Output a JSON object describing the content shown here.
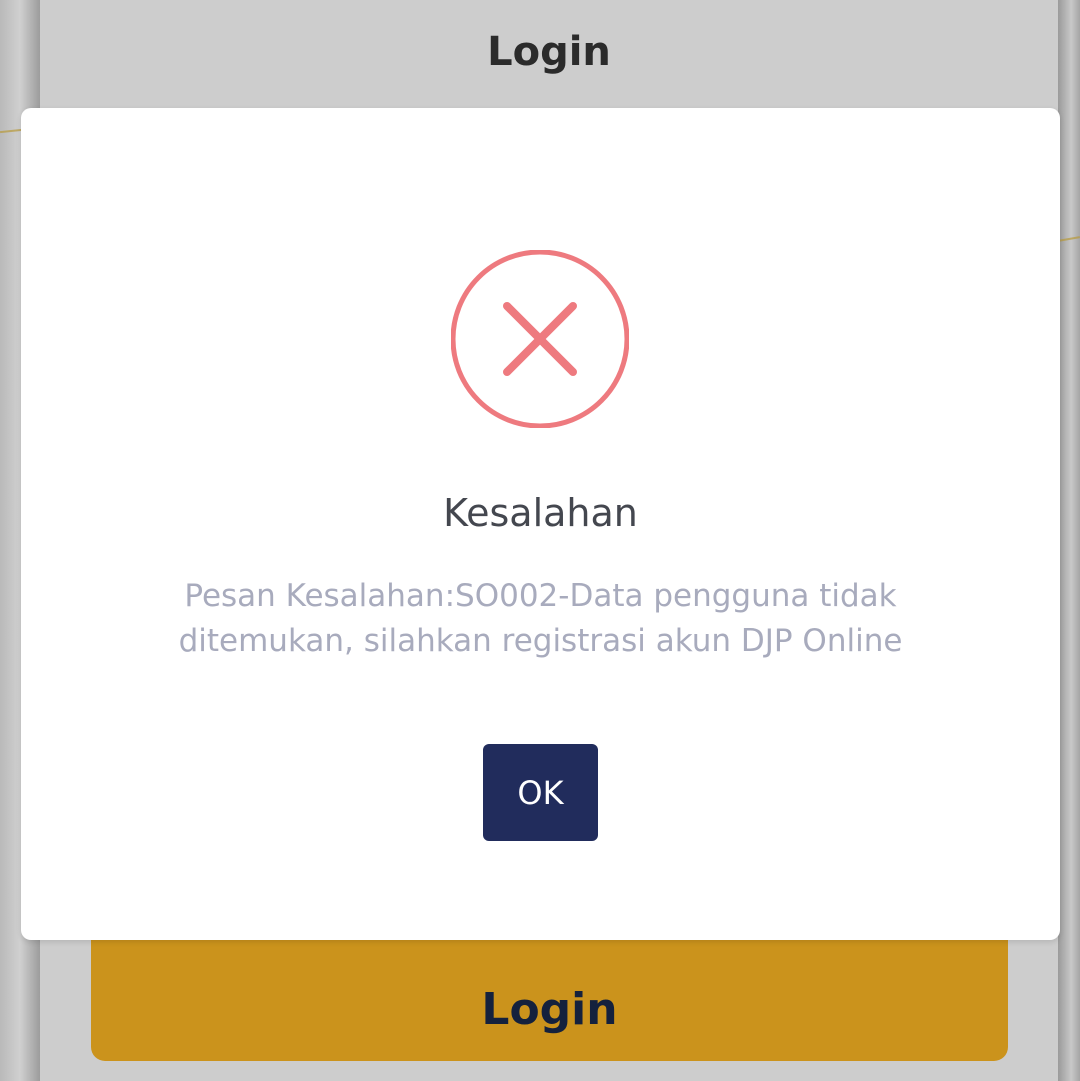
{
  "header": {
    "title": "Login"
  },
  "login_form": {
    "submit_label": "Login"
  },
  "dialog": {
    "icon": "error-x-icon",
    "title": "Kesalahan",
    "message": "Pesan Kesalahan:SO002-Data pengguna tidak ditemukan, silahkan registrasi akun DJP Online",
    "ok_label": "OK"
  },
  "colors": {
    "error_icon": "#ee7a7f",
    "ok_button": "#212c5c",
    "login_button": "#cb931c",
    "overlay_panel": "#cdcdcd"
  }
}
